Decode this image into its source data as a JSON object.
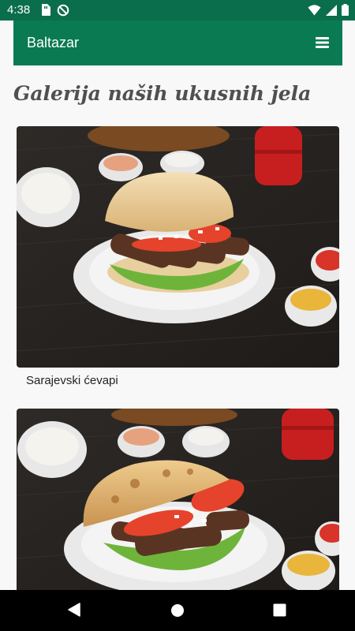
{
  "status_bar": {
    "time": "4:38"
  },
  "app_bar": {
    "brand": "Baltazar"
  },
  "page": {
    "title": "Galerija naših ukusnih jela"
  },
  "gallery": [
    {
      "caption": "Sarajevski ćevapi"
    },
    {
      "caption": ""
    }
  ],
  "colors": {
    "primary": "#0a7a53",
    "status_bar": "#0a6e4c",
    "title": "#505050"
  }
}
